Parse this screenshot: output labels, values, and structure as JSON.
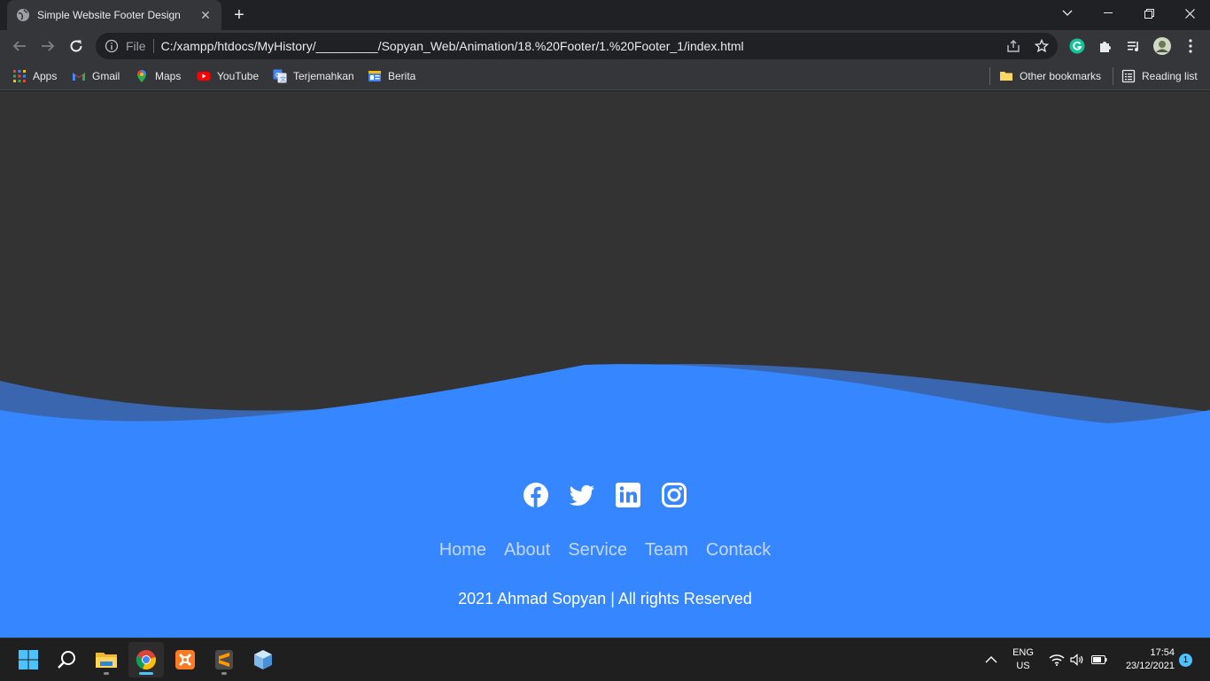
{
  "browser": {
    "tab_title": "Simple Website Footer Design",
    "tab_close": "✕",
    "new_tab": "+",
    "scheme": "File",
    "url": "C:/xampp/htdocs/MyHistory/_________/Sopyan_Web/Animation/18.%20Footer/1.%20Footer_1/index.html"
  },
  "bookmarks": {
    "items": [
      {
        "label": "Apps",
        "icon": "apps-grid-icon"
      },
      {
        "label": "Gmail",
        "icon": "gmail-icon"
      },
      {
        "label": "Maps",
        "icon": "maps-icon"
      },
      {
        "label": "YouTube",
        "icon": "youtube-icon"
      },
      {
        "label": "Terjemahkan",
        "icon": "translate-icon"
      },
      {
        "label": "Berita",
        "icon": "news-icon"
      }
    ],
    "other": "Other bookmarks",
    "reading_list": "Reading list"
  },
  "footer": {
    "social": [
      "facebook-icon",
      "twitter-icon",
      "linkedin-icon",
      "instagram-icon"
    ],
    "menu": [
      "Home",
      "About",
      "Service",
      "Team",
      "Contack"
    ],
    "copyright": "2021 Ahmad Sopyan | All rights Reserved",
    "colors": {
      "background": "#333333",
      "footer": "#3586ff",
      "wave_back": "#3a66b0"
    }
  },
  "taskbar": {
    "apps": [
      "windows-start-icon",
      "search-icon",
      "file-explorer-icon",
      "chrome-icon",
      "xampp-icon",
      "sublime-text-icon",
      "3d-box-icon"
    ],
    "lang_line1": "ENG",
    "lang_line2": "US",
    "time": "17:54",
    "date": "23/12/2021",
    "notifications": "1"
  }
}
